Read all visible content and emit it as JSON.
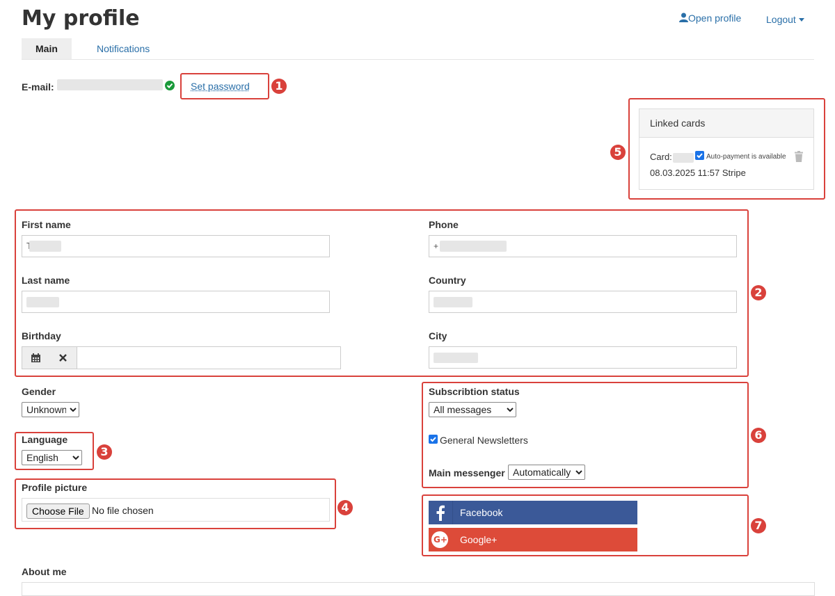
{
  "header": {
    "title": "My profile",
    "open_profile": "Open profile",
    "logout": "Logout"
  },
  "tabs": [
    {
      "label": "Main",
      "active": true
    },
    {
      "label": "Notifications",
      "active": false
    }
  ],
  "account": {
    "email_label": "E-mail:",
    "set_password": "Set password"
  },
  "linked_cards": {
    "title": "Linked cards",
    "card_label": "Card:",
    "auto_payment_label": "Auto-payment is available",
    "auto_payment_checked": true,
    "details": "08.03.2025 11:57 Stripe"
  },
  "fields": {
    "first_name": {
      "label": "First name",
      "value": "T"
    },
    "last_name": {
      "label": "Last name"
    },
    "birthday": {
      "label": "Birthday"
    },
    "phone": {
      "label": "Phone",
      "value": "+"
    },
    "country": {
      "label": "Country"
    },
    "city": {
      "label": "City"
    },
    "gender": {
      "label": "Gender",
      "selected": "Unknown"
    },
    "language": {
      "label": "Language",
      "selected": "English"
    },
    "profile_picture": {
      "label": "Profile picture",
      "button": "Choose File",
      "status": "No file chosen"
    },
    "subscription": {
      "label": "Subscribtion status",
      "selected": "All messages"
    },
    "newsletter": {
      "label": "General Newsletters",
      "checked": true
    },
    "main_messenger": {
      "label": "Main messenger",
      "selected": "Automatically"
    },
    "about_me": {
      "label": "About me"
    }
  },
  "social": {
    "facebook": "Facebook",
    "google": "Google+"
  },
  "annotations": [
    "1",
    "2",
    "3",
    "4",
    "5",
    "6",
    "7"
  ],
  "colors": {
    "link": "#2a6fa8",
    "annotation_red": "#d9413b",
    "facebook_blue": "#3b5998",
    "google_red": "#dd4b39",
    "verified_green": "#1a9a3a"
  }
}
